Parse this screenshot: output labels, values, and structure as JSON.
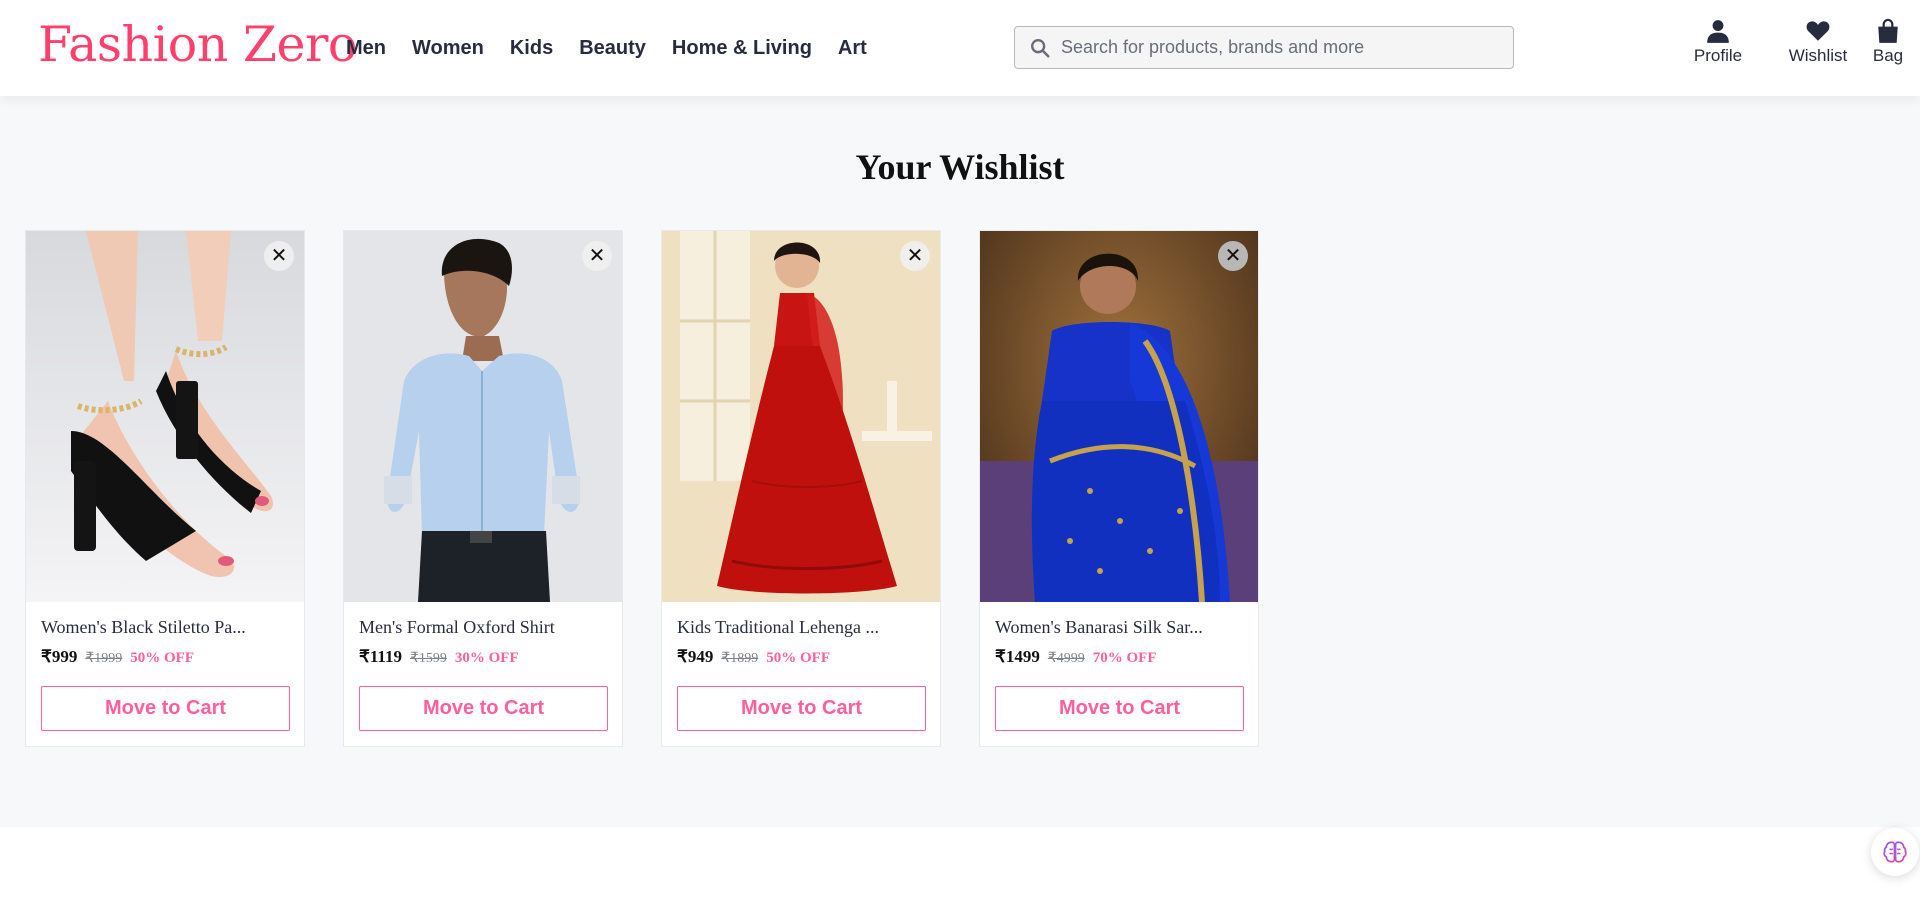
{
  "header": {
    "logo": "Fashion Zero",
    "nav": [
      "Men",
      "Women",
      "Kids",
      "Beauty",
      "Home & Living",
      "Art"
    ],
    "search": {
      "placeholder": "Search for products, brands and more",
      "value": ""
    },
    "actions": {
      "profile": "Profile",
      "wishlist": "Wishlist",
      "bag": "Bag"
    },
    "icons": {
      "search": "search-icon",
      "profile": "user-icon",
      "wishlist": "heart-icon",
      "bag": "shopping-bag-icon"
    }
  },
  "main": {
    "title": "Your Wishlist",
    "items": [
      {
        "name": "Women's Black Stiletto Pa...",
        "price": "₹999",
        "mrp": "₹1999",
        "discount": "50% OFF",
        "cta": "Move to Cart",
        "remove": "✕"
      },
      {
        "name": "Men's Formal Oxford Shirt",
        "price": "₹1119",
        "mrp": "₹1599",
        "discount": "30% OFF",
        "cta": "Move to Cart",
        "remove": "✕"
      },
      {
        "name": "Kids Traditional Lehenga ...",
        "price": "₹949",
        "mrp": "₹1899",
        "discount": "50% OFF",
        "cta": "Move to Cart",
        "remove": "✕"
      },
      {
        "name": "Women's Banarasi Silk Sar...",
        "price": "₹1499",
        "mrp": "₹4999",
        "discount": "70% OFF",
        "cta": "Move to Cart",
        "remove": "✕"
      }
    ]
  },
  "colors": {
    "brand": "#ff3f6c",
    "accent": "#ff5f9e",
    "text": "#282c3f",
    "background": "#f7f8fa"
  }
}
